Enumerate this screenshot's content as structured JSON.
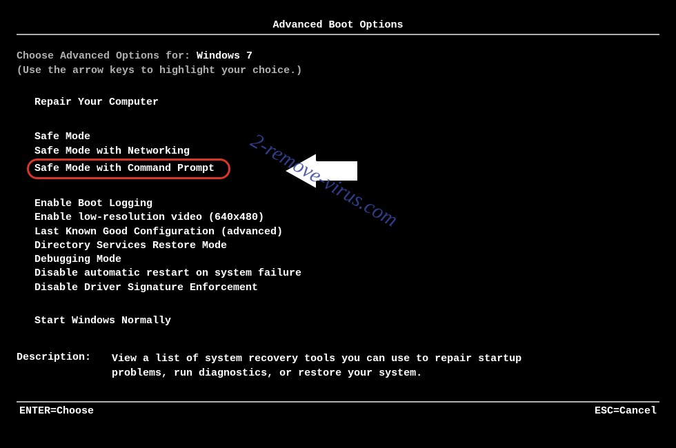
{
  "title": "Advanced Boot Options",
  "choose_prefix": "Choose Advanced Options for: ",
  "os_name": "Windows 7",
  "arrow_hint": "(Use the arrow keys to highlight your choice.)",
  "group1": [
    "Repair Your Computer"
  ],
  "group2": [
    "Safe Mode",
    "Safe Mode with Networking",
    "Safe Mode with Command Prompt"
  ],
  "group3": [
    "Enable Boot Logging",
    "Enable low-resolution video (640x480)",
    "Last Known Good Configuration (advanced)",
    "Directory Services Restore Mode",
    "Debugging Mode",
    "Disable automatic restart on system failure",
    "Disable Driver Signature Enforcement"
  ],
  "group4": [
    "Start Windows Normally"
  ],
  "highlighted_index": {
    "group": 2,
    "item": 2
  },
  "description_label": "Description:",
  "description_text": "View a list of system recovery tools you can use to repair startup problems, run diagnostics, or restore your system.",
  "footer_left": "ENTER=Choose",
  "footer_right": "ESC=Cancel",
  "watermark": "2-remove-virus.com",
  "annotation": {
    "highlight_color": "#d9362b"
  }
}
